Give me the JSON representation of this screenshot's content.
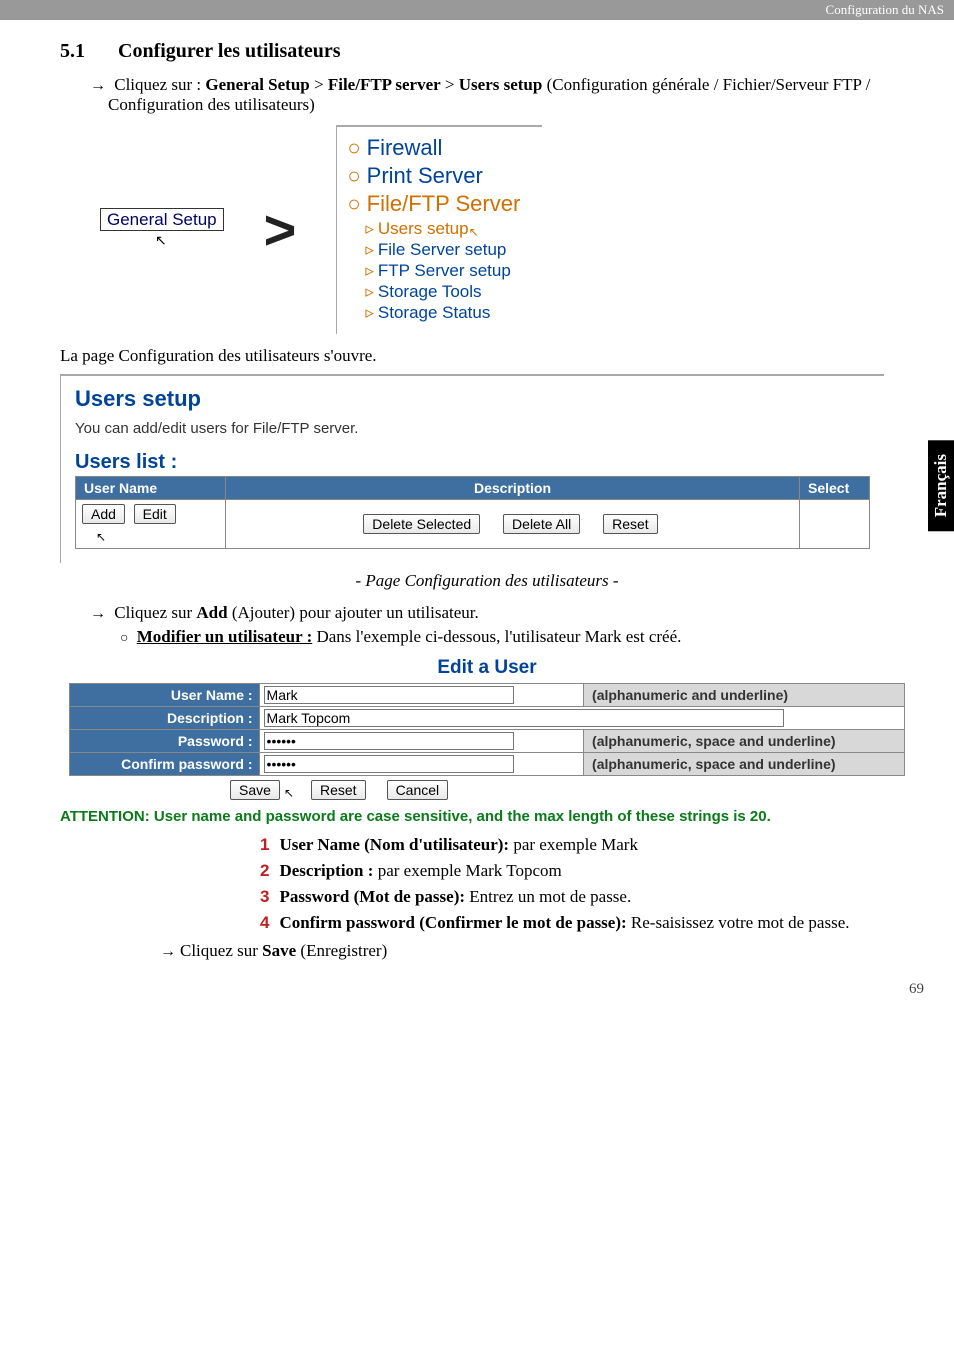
{
  "header": {
    "right": "Configuration du NAS"
  },
  "section": {
    "number": "5.1",
    "title": "Configurer les utilisateurs"
  },
  "intro": {
    "prefix": "Cliquez sur : ",
    "path1": "General Setup",
    "path2": "File/FTP server",
    "path3": "Users setup",
    "suffix": " (Configuration générale / Fichier/Serveur FTP / Configuration des utilisateurs)"
  },
  "nav": {
    "general_setup": "General Setup",
    "firewall": "Firewall",
    "print": "Print Server",
    "fileftp": "File/FTP Server",
    "sub": {
      "users": "Users setup",
      "file": "File Server setup",
      "ftp": "FTP Server setup",
      "tools": "Storage Tools",
      "status": "Storage Status"
    }
  },
  "line_open": "La page Configuration des utilisateurs s'ouvre.",
  "users_setup": {
    "title": "Users setup",
    "sub": "You can add/edit users for File/FTP server.",
    "list_title": "Users list  :",
    "th_user": "User Name",
    "th_desc": "Description",
    "th_select": "Select",
    "btn_add": "Add",
    "btn_edit": "Edit",
    "btn_delsel": "Delete Selected",
    "btn_delall": "Delete All",
    "btn_reset": "Reset"
  },
  "caption1": "- Page Configuration des utilisateurs -",
  "add_line": {
    "pre": "Cliquez sur ",
    "b": "Add",
    "post": " (Ajouter) pour ajouter un utilisateur."
  },
  "modify": {
    "b": "Modifier un utilisateur :",
    "post": " Dans l'exemple ci-dessous, l'utilisateur Mark est créé."
  },
  "edit": {
    "title": "Edit a User",
    "r_user": "User Name  :",
    "v_user": "Mark",
    "h_user": "(alphanumeric and underline)",
    "r_desc": "Description  :",
    "v_desc": "Mark Topcom",
    "r_pass": "Password  :",
    "v_pass": "••••••",
    "h_pass": "(alphanumeric, space and underline)",
    "r_conf": "Confirm password  :",
    "v_conf": "••••••",
    "h_conf": "(alphanumeric, space and underline)",
    "btn_save": "Save",
    "btn_reset": "Reset",
    "btn_cancel": "Cancel"
  },
  "attention": "ATTENTION: User name and password are case sensitive, and the max length of these strings is 20.",
  "list": {
    "i1b": "User Name (Nom d'utilisateur):",
    "i1": " par exemple Mark",
    "i2b": "Description :",
    "i2": " par exemple Mark Topcom",
    "i3b": "Password (Mot de passe):",
    "i3": " Entrez un mot de passe.",
    "i4b": "Confirm password (Confirmer le mot de passe):",
    "i4": " Re-saisissez votre mot de passe."
  },
  "save_line": {
    "pre": "Cliquez sur ",
    "b": "Save",
    "post": " (Enregistrer)"
  },
  "side": "Français",
  "page": "69"
}
